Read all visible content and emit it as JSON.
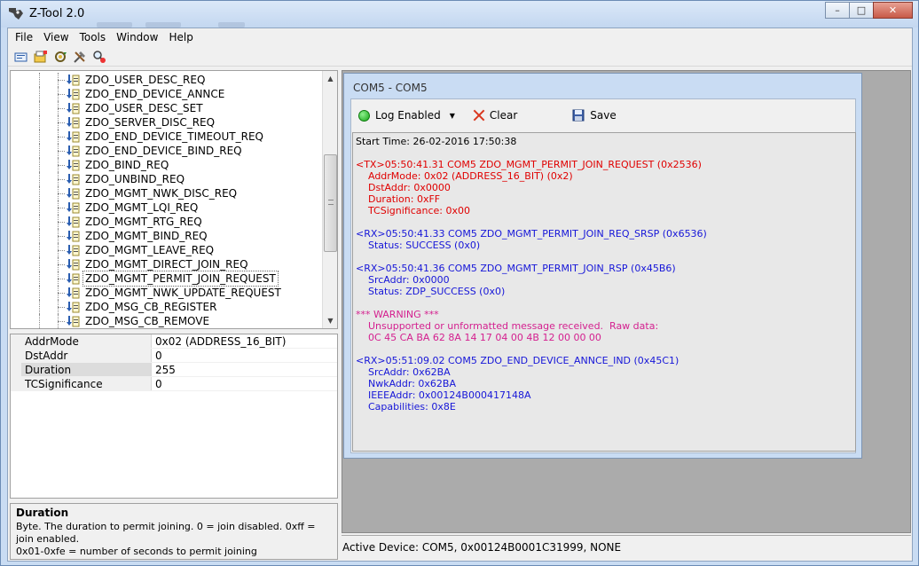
{
  "window": {
    "title": "Z-Tool 2.0",
    "minimize": "–",
    "maximize": "□",
    "close": "✕"
  },
  "menu": [
    "File",
    "View",
    "Tools",
    "Window",
    "Help"
  ],
  "toolbar_icons": [
    "open-icon",
    "folder-add-icon",
    "gear-refresh-icon",
    "tools-icon",
    "search-device-icon"
  ],
  "tree": {
    "items": [
      "ZDO_USER_DESC_REQ",
      "ZDO_END_DEVICE_ANNCE",
      "ZDO_USER_DESC_SET",
      "ZDO_SERVER_DISC_REQ",
      "ZDO_END_DEVICE_TIMEOUT_REQ",
      "ZDO_END_DEVICE_BIND_REQ",
      "ZDO_BIND_REQ",
      "ZDO_UNBIND_REQ",
      "ZDO_MGMT_NWK_DISC_REQ",
      "ZDO_MGMT_LQI_REQ",
      "ZDO_MGMT_RTG_REQ",
      "ZDO_MGMT_BIND_REQ",
      "ZDO_MGMT_LEAVE_REQ",
      "ZDO_MGMT_DIRECT_JOIN_REQ",
      "ZDO_MGMT_PERMIT_JOIN_REQUEST",
      "ZDO_MGMT_NWK_UPDATE_REQUEST",
      "ZDO_MSG_CB_REGISTER",
      "ZDO_MSG_CB_REMOVE"
    ],
    "selected_index": 14
  },
  "properties": [
    {
      "name": "AddrMode",
      "value": "0x02 (ADDRESS_16_BIT)"
    },
    {
      "name": "DstAddr",
      "value": "0"
    },
    {
      "name": "Duration",
      "value": "255"
    },
    {
      "name": "TCSignificance",
      "value": "0"
    }
  ],
  "help": {
    "title": "Duration",
    "line1": "Byte.  The duration to permit joining.  0 = join disabled.  0xff = join enabled.",
    "line2": "0x01-0xfe = number of seconds to permit joining"
  },
  "child_window": {
    "title": "COM5 - COM5",
    "log_enabled_label": "Log Enabled",
    "clear_label": "Clear",
    "save_label": "Save"
  },
  "log": [
    {
      "t": "black",
      "s": "Start Time: 26-02-2016 17:50:38"
    },
    {
      "t": "gap",
      "s": ""
    },
    {
      "t": "tx",
      "s": "<TX>05:50:41.31 COM5 ZDO_MGMT_PERMIT_JOIN_REQUEST (0x2536)"
    },
    {
      "t": "tx",
      "s": "    AddrMode: 0x02 (ADDRESS_16_BIT) (0x2)"
    },
    {
      "t": "tx",
      "s": "    DstAddr: 0x0000"
    },
    {
      "t": "tx",
      "s": "    Duration: 0xFF"
    },
    {
      "t": "tx",
      "s": "    TCSignificance: 0x00"
    },
    {
      "t": "gap",
      "s": ""
    },
    {
      "t": "rx",
      "s": "<RX>05:50:41.33 COM5 ZDO_MGMT_PERMIT_JOIN_REQ_SRSP (0x6536)"
    },
    {
      "t": "rx",
      "s": "    Status: SUCCESS (0x0)"
    },
    {
      "t": "gap",
      "s": ""
    },
    {
      "t": "rx",
      "s": "<RX>05:50:41.36 COM5 ZDO_MGMT_PERMIT_JOIN_RSP (0x45B6)"
    },
    {
      "t": "rx",
      "s": "    SrcAddr: 0x0000"
    },
    {
      "t": "rx",
      "s": "    Status: ZDP_SUCCESS (0x0)"
    },
    {
      "t": "gap",
      "s": ""
    },
    {
      "t": "warn",
      "s": "*** WARNING ***"
    },
    {
      "t": "warn",
      "s": "    Unsupported or unformatted message received.  Raw data:"
    },
    {
      "t": "warn",
      "s": "    0C 45 CA BA 62 8A 14 17 04 00 4B 12 00 00 00"
    },
    {
      "t": "gap",
      "s": ""
    },
    {
      "t": "rx",
      "s": "<RX>05:51:09.02 COM5 ZDO_END_DEVICE_ANNCE_IND (0x45C1)"
    },
    {
      "t": "rx",
      "s": "    SrcAddr: 0x62BA"
    },
    {
      "t": "rx",
      "s": "    NwkAddr: 0x62BA"
    },
    {
      "t": "rx",
      "s": "    IEEEAddr: 0x00124B000417148A"
    },
    {
      "t": "rx",
      "s": "    Capabilities: 0x8E"
    }
  ],
  "status_bar": "Active Device: COM5, 0x00124B0001C31999, NONE"
}
